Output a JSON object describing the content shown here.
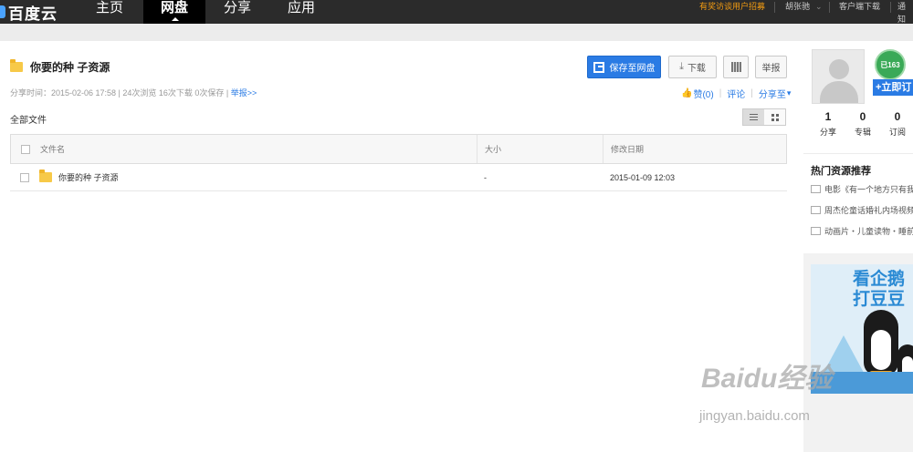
{
  "topnav": {
    "logo_text": "百度云",
    "items": [
      {
        "label": "主页"
      },
      {
        "label": "网盘"
      },
      {
        "label": "分享"
      },
      {
        "label": "应用"
      }
    ],
    "promo": "有奖访谈用户招募",
    "username": "胡张驰",
    "client_download": "客户端下载",
    "notice": "通知"
  },
  "file": {
    "title": "你要的种 子资源",
    "save_button": "保存至网盘",
    "download_button": "下载",
    "report_button": "举报",
    "meta_text": "分享时间：2015-02-06 17:58 | 24次浏览 16次下载 0次保存 | ",
    "meta_report": "举报>>",
    "like": "赞(0)",
    "comment": "评论",
    "share_to": "分享至"
  },
  "list": {
    "all_files": "全部文件",
    "headers": {
      "name": "文件名",
      "size": "大小",
      "date": "修改日期"
    },
    "rows": [
      {
        "name": "你要的种  子资源",
        "size": "-",
        "date": "2015-01-09 12:03"
      }
    ]
  },
  "sidebar": {
    "badge": "已163",
    "follow": "+立即订",
    "stats": [
      {
        "num": "1",
        "label": "分享"
      },
      {
        "num": "0",
        "label": "专辑"
      },
      {
        "num": "0",
        "label": "订阅"
      }
    ],
    "hot_title": "热门资源推荐",
    "hot_items": [
      {
        "label": "电影《有一个地方只有我们知道》"
      },
      {
        "label": "周杰伦童话婚礼内场视频"
      },
      {
        "label": "动画片・儿童读物・睡前故事"
      }
    ],
    "ad_line1": "看企鹅",
    "ad_line2": "打豆豆"
  },
  "watermark": {
    "main": "Baidu经验",
    "sub": "jingyan.baidu.com"
  },
  "colors": {
    "topbar": "#2b2b2b",
    "accent": "#2a7be4",
    "promo": "#f39c12"
  }
}
